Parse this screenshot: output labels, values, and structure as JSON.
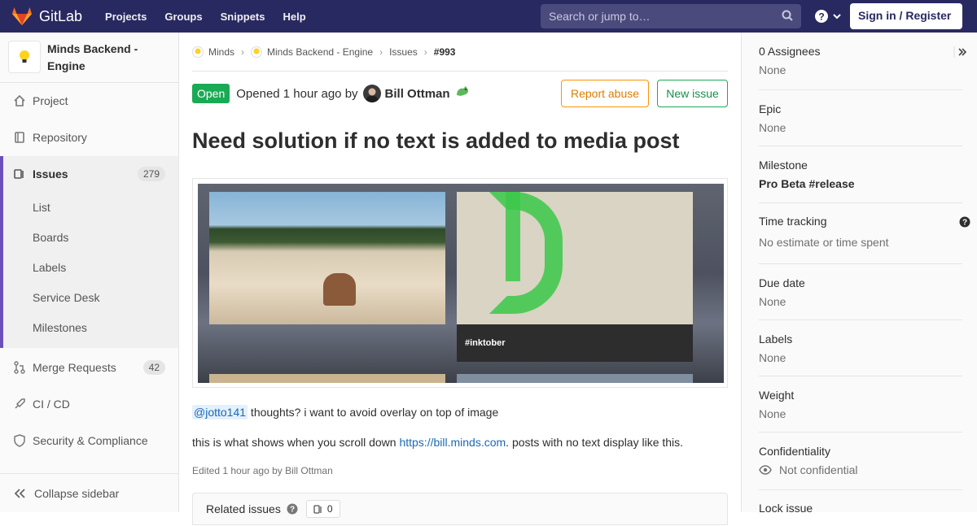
{
  "navbar": {
    "brand": "GitLab",
    "links": [
      "Projects",
      "Groups",
      "Snippets",
      "Help"
    ],
    "search_placeholder": "Search or jump to…",
    "signin_label": "Sign in / Register"
  },
  "sidebar": {
    "project_name": "Minds Backend - Engine",
    "items": [
      {
        "label": "Project",
        "icon": "home-icon"
      },
      {
        "label": "Repository",
        "icon": "book-icon"
      },
      {
        "label": "Issues",
        "icon": "issues-icon",
        "count": "279"
      },
      {
        "label": "Merge Requests",
        "icon": "merge-request-icon",
        "count": "42"
      },
      {
        "label": "CI / CD",
        "icon": "rocket-icon"
      },
      {
        "label": "Security & Compliance",
        "icon": "shield-icon"
      }
    ],
    "issue_subitems": [
      "List",
      "Boards",
      "Labels",
      "Service Desk",
      "Milestones"
    ],
    "collapse_label": "Collapse sidebar"
  },
  "breadcrumbs": [
    "Minds",
    "Minds Backend - Engine",
    "Issues",
    "#993"
  ],
  "issue": {
    "status": "Open",
    "opened_text": "Opened 1 hour ago by",
    "author": "Bill Ottman",
    "report_abuse_label": "Report abuse",
    "new_issue_label": "New issue",
    "title": "Need solution if no text is added to media post",
    "screenshot_caption": "#inktober",
    "mention": "@jotto141",
    "comment1": " thoughts? i want to avoid overlay on top of image",
    "comment2_before": "this is what shows when you scroll down ",
    "comment2_link": "https://bill.minds.com",
    "comment2_after": ". posts with no text display like this.",
    "edited": "Edited 1 hour ago by Bill Ottman",
    "related_label": "Related issues",
    "related_count": "0"
  },
  "rightbar": {
    "assignees_label": "0 Assignees",
    "assignees_value": "None",
    "epic_label": "Epic",
    "epic_value": "None",
    "milestone_label": "Milestone",
    "milestone_value": "Pro Beta #release",
    "time_label": "Time tracking",
    "time_value": "No estimate or time spent",
    "due_label": "Due date",
    "due_value": "None",
    "labels_label": "Labels",
    "labels_value": "None",
    "weight_label": "Weight",
    "weight_value": "None",
    "conf_label": "Confidentiality",
    "conf_value": "Not confidential",
    "lock_label": "Lock issue"
  },
  "colors": {
    "navbar": "#292961",
    "open_status": "#1aaa55",
    "accent": "#6b4fbb",
    "link": "#1b69b6"
  }
}
